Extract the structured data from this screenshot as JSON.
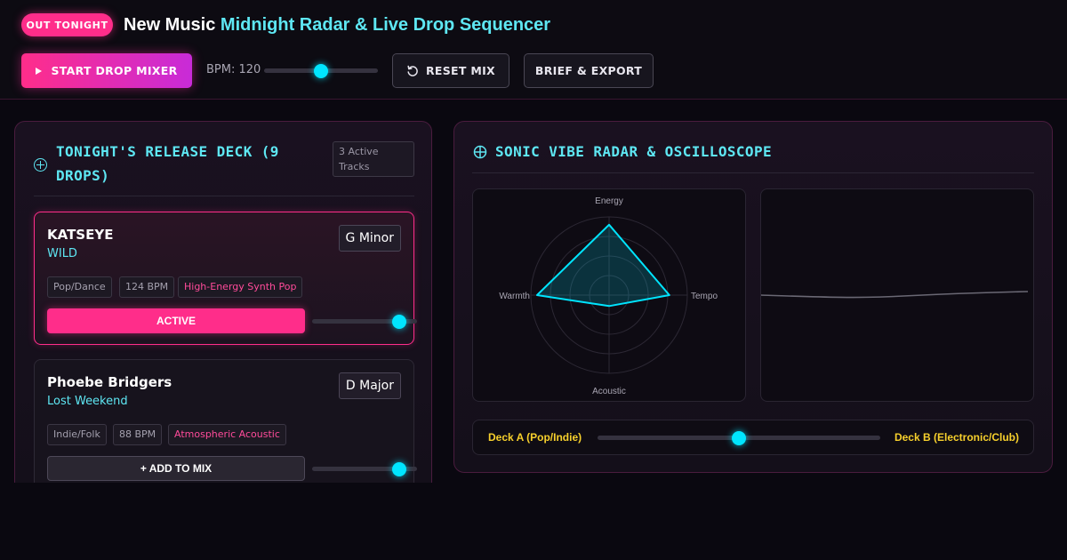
{
  "header": {
    "badge": "OUT TONIGHT",
    "title_part1": "New Music",
    "title_part2": "Midnight Radar & Live Drop Sequencer",
    "start_button": "START DROP MIXER",
    "bpm_label": "BPM: 120",
    "bpm_value": 120,
    "bpm_slider_fraction": 0.5,
    "reset_button": "RESET MIX",
    "brief_button": "BRIEF & EXPORT"
  },
  "release_deck": {
    "title": "TONIGHT'S RELEASE DECK (9 DROPS)",
    "active_count": "3 Active Tracks",
    "tracks": [
      {
        "artist": "KATSEYE",
        "song": "WILD",
        "key": "G Minor",
        "tags": [
          "Pop/Dance",
          "124 BPM",
          "High-Energy Synth Pop"
        ],
        "button": "ACTIVE",
        "active": true,
        "volume_fraction": 0.83
      },
      {
        "artist": "Phoebe Bridgers",
        "song": "Lost Weekend",
        "key": "D Major",
        "tags": [
          "Indie/Folk",
          "88 BPM",
          "Atmospheric Acoustic"
        ],
        "button": "+ ADD TO MIX",
        "active": false,
        "volume_fraction": 0.83
      }
    ]
  },
  "radar_panel": {
    "title": "SONIC VIBE RADAR & OSCILLOSCOPE",
    "axes": [
      "Energy",
      "Tempo",
      "Acoustic",
      "Warmth"
    ],
    "values": {
      "Energy": 0.9,
      "Tempo": 0.77,
      "Acoustic": 0.14,
      "Warmth": 0.92
    },
    "radar_color": "#00e5ff"
  },
  "crossfader": {
    "deck_a": "Deck A (Pop/Indie)",
    "deck_b": "Deck B (Electronic/Club)",
    "position_fraction": 0.5
  },
  "colors": {
    "accent_pink": "#ff2d8a",
    "accent_cyan": "#5ee7f3",
    "deck_yellow": "#f7d02c"
  }
}
